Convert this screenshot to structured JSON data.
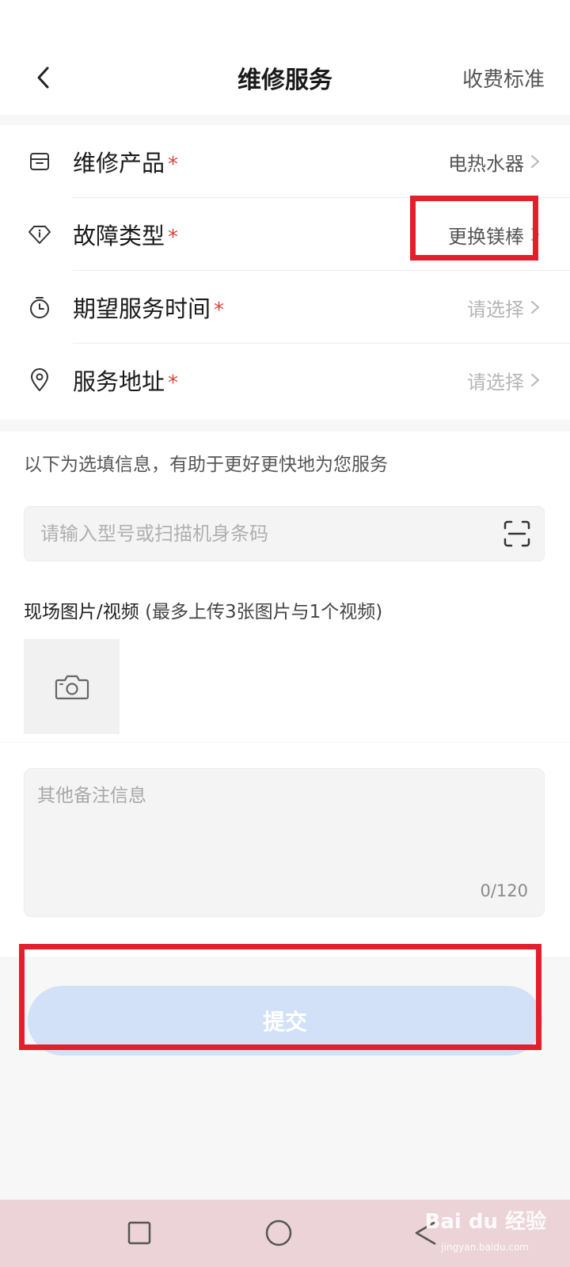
{
  "header": {
    "title": "维修服务",
    "fee_link": "收费标准"
  },
  "form": {
    "rows": [
      {
        "label": "维修产品",
        "required": "*",
        "value": "电热水器",
        "icon": "box-icon",
        "is_placeholder": false
      },
      {
        "label": "故障类型",
        "required": "*",
        "value": "更换镁棒",
        "icon": "diamond-info-icon",
        "is_placeholder": false
      },
      {
        "label": "期望服务时间",
        "required": "*",
        "value": "请选择",
        "icon": "stopwatch-icon",
        "is_placeholder": true
      },
      {
        "label": "服务地址",
        "required": "*",
        "value": "请选择",
        "icon": "location-pin-icon",
        "is_placeholder": true
      }
    ]
  },
  "optional": {
    "hint": "以下为选填信息，有助于更好更快地为您服务",
    "model_input_placeholder": "请输入型号或扫描机身条码",
    "media_label": "现场图片/视频",
    "media_sub": "(最多上传3张图片与1个视频)"
  },
  "remarks": {
    "placeholder": "其他备注信息",
    "char_count": "0/120"
  },
  "submit": {
    "label": "提交"
  },
  "watermark": {
    "logo_text": "Bai du 经验",
    "url": "jingyan.baidu.com"
  },
  "colors": {
    "required_star": "#d9463b",
    "submit_bg": "#d2e1f7",
    "highlight": "#e41e2a",
    "nav_bg": "#ecd3d8"
  }
}
